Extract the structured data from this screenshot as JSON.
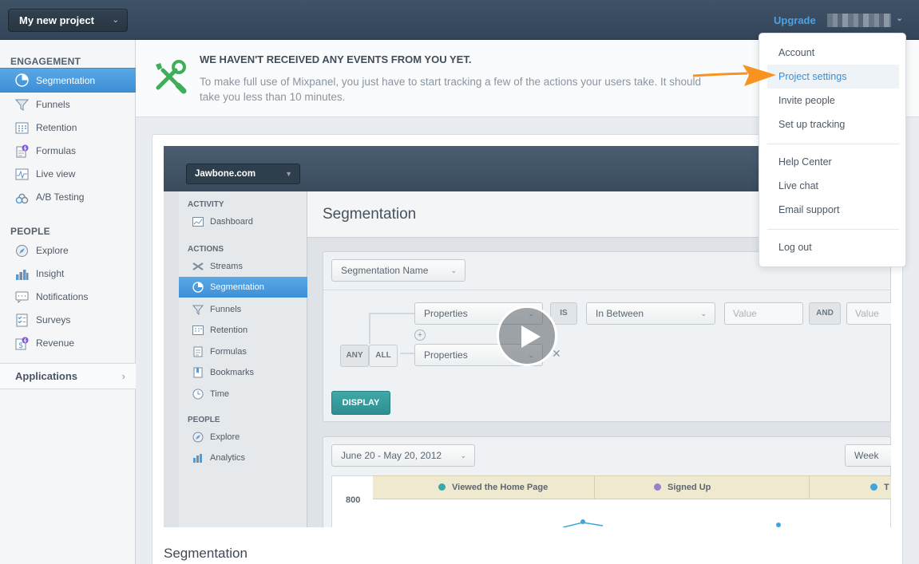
{
  "topbar": {
    "project_selector": "My new project",
    "upgrade": "Upgrade"
  },
  "sidebar": {
    "engagement_heading": "ENGAGEMENT",
    "engagement_items": [
      {
        "label": "Segmentation",
        "icon": "pie-chart-icon",
        "active": true
      },
      {
        "label": "Funnels",
        "icon": "funnel-icon"
      },
      {
        "label": "Retention",
        "icon": "grid-icon"
      },
      {
        "label": "Formulas",
        "icon": "formula-icon"
      },
      {
        "label": "Live view",
        "icon": "pulse-icon"
      },
      {
        "label": "A/B Testing",
        "icon": "flask-icon"
      }
    ],
    "people_heading": "PEOPLE",
    "people_items": [
      {
        "label": "Explore",
        "icon": "compass-icon"
      },
      {
        "label": "Insight",
        "icon": "bar-chart-icon"
      },
      {
        "label": "Notifications",
        "icon": "message-icon"
      },
      {
        "label": "Surveys",
        "icon": "checklist-icon"
      },
      {
        "label": "Revenue",
        "icon": "dollar-icon"
      }
    ],
    "applications": "Applications"
  },
  "notice": {
    "title": "WE HAVEN'T RECEIVED ANY EVENTS FROM YOU YET.",
    "text": "To make full use of Mixpanel, you just have to start tracking a few of the actions your users take. It should take you less than 10 minutes."
  },
  "video": {
    "project": "Jawbone.com",
    "activity_heading": "ACTIVITY",
    "activity_items": [
      "Dashboard"
    ],
    "actions_heading": "ACTIONS",
    "actions_items": [
      "Streams",
      "Segmentation",
      "Funnels",
      "Retention",
      "Formulas",
      "Bookmarks",
      "Time"
    ],
    "people_heading": "PEOPLE",
    "people_items": [
      "Explore",
      "Analytics"
    ],
    "title": "Segmentation",
    "segmentation_name": "Segmentation Name",
    "properties_1": "Properties",
    "is": "IS",
    "in_between": "In Between",
    "value_1": "Value",
    "and": "AND",
    "value_2": "Value",
    "any": "ANY",
    "all": "ALL",
    "properties_2": "Properties",
    "display": "DISPLAY",
    "date_range": "June 20 - May 20, 2012",
    "week": "Week",
    "legend": [
      "Viewed the Home Page",
      "Signed Up",
      "T"
    ],
    "legend_colors": [
      "#3aa7a8",
      "#9b7fc9",
      "#3ea6d8"
    ],
    "y_tick": "800"
  },
  "card_caption": "Segmentation",
  "dropdown": {
    "items": [
      "Account",
      "Project settings",
      "Invite people",
      "Set up tracking",
      "Help Center",
      "Live chat",
      "Email support",
      "Log out"
    ],
    "highlighted": "Project settings"
  },
  "colors": {
    "accent": "#3d8fd6",
    "arrow": "#f7931e",
    "display_button": "#2f8f90"
  }
}
